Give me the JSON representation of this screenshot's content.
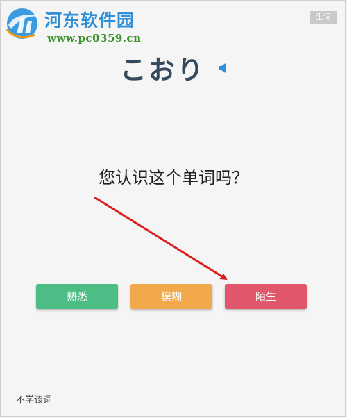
{
  "watermark": {
    "title": "河东软件园",
    "url": "www.pc0359.cn"
  },
  "header": {
    "tag_button": "生词"
  },
  "word": {
    "text": "こおり",
    "audio_icon": "speaker-icon"
  },
  "prompt": {
    "question": "您认识这个单词吗？"
  },
  "choices": [
    {
      "label": "熟悉",
      "color": "#4dbd86"
    },
    {
      "label": "模糊",
      "color": "#f2a94b"
    },
    {
      "label": "陌生",
      "color": "#e0566a"
    }
  ],
  "footer": {
    "skip_label": "不学该词"
  },
  "annotation": {
    "arrow_color": "#d81e1e"
  }
}
